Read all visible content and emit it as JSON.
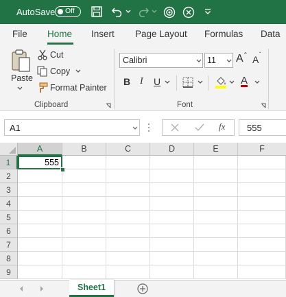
{
  "titlebar": {
    "autosave_label": "AutoSave",
    "autosave_state": "Off",
    "icons": [
      "save-icon",
      "undo-icon",
      "redo-icon",
      "touch-mode-icon",
      "stop-icon",
      "customize-qat-icon"
    ]
  },
  "tabs": [
    "File",
    "Home",
    "Insert",
    "Page Layout",
    "Formulas",
    "Data"
  ],
  "active_tab": "Home",
  "clipboard": {
    "paste": "Paste",
    "cut": "Cut",
    "copy": "Copy",
    "format_painter": "Format Painter",
    "group_label": "Clipboard"
  },
  "font": {
    "name": "Calibri",
    "size": "11",
    "bold": "B",
    "italic": "I",
    "underline": "U",
    "font_color_glyph": "A",
    "group_label": "Font",
    "increase_size": "A",
    "decrease_size": "A"
  },
  "formula_bar": {
    "name_box": "A1",
    "fx": "fx",
    "value": "555"
  },
  "grid": {
    "columns": [
      "A",
      "B",
      "C",
      "D",
      "E",
      "F"
    ],
    "rows": [
      "1",
      "2",
      "3",
      "4",
      "5",
      "6",
      "7",
      "8",
      "9"
    ],
    "a1_value": "555",
    "active_cell": "A1"
  },
  "sheets": {
    "active": "Sheet1"
  },
  "colors": {
    "accent": "#217346",
    "fill_color": "#ffff00",
    "font_color": "#c00000"
  }
}
